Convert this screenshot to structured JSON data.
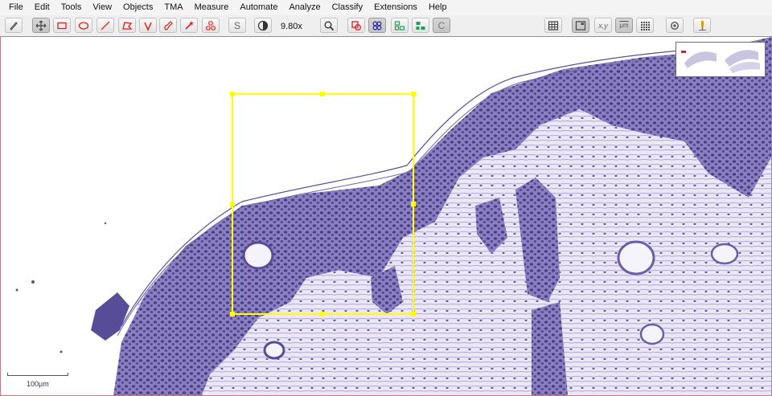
{
  "menu": {
    "items": [
      "File",
      "Edit",
      "Tools",
      "View",
      "Objects",
      "TMA",
      "Measure",
      "Automate",
      "Analyze",
      "Classify",
      "Extensions",
      "Help"
    ]
  },
  "toolbar": {
    "zoom_value": "9.80x",
    "zoom_slider_fraction": 0.93,
    "tools": [
      {
        "name": "brush-tool-icon",
        "selected": false
      },
      {
        "name": "move-tool-icon",
        "selected": true
      },
      {
        "name": "rectangle-tool-icon",
        "selected": false
      },
      {
        "name": "ellipse-tool-icon",
        "selected": false
      },
      {
        "name": "line-tool-icon",
        "selected": false
      },
      {
        "name": "polygon-tool-icon",
        "selected": false
      },
      {
        "name": "polyline-tool-icon",
        "selected": false
      },
      {
        "name": "brush-draw-tool-icon",
        "selected": false
      },
      {
        "name": "wand-tool-icon",
        "selected": false
      },
      {
        "name": "points-tool-icon",
        "selected": false
      }
    ],
    "selection_mode_label": "S",
    "counts_label": "C",
    "coordinates_label": "x,y",
    "scalebar_toggle_label": "μm"
  },
  "viewer": {
    "scalebar_label": "100μm",
    "annotation_color": "#ffff00",
    "stain_color": "#5a4f9c"
  },
  "colors": {
    "annotation": "#ff2a2a",
    "detection": "#2a2aa8",
    "classification": "#1fa05a"
  }
}
